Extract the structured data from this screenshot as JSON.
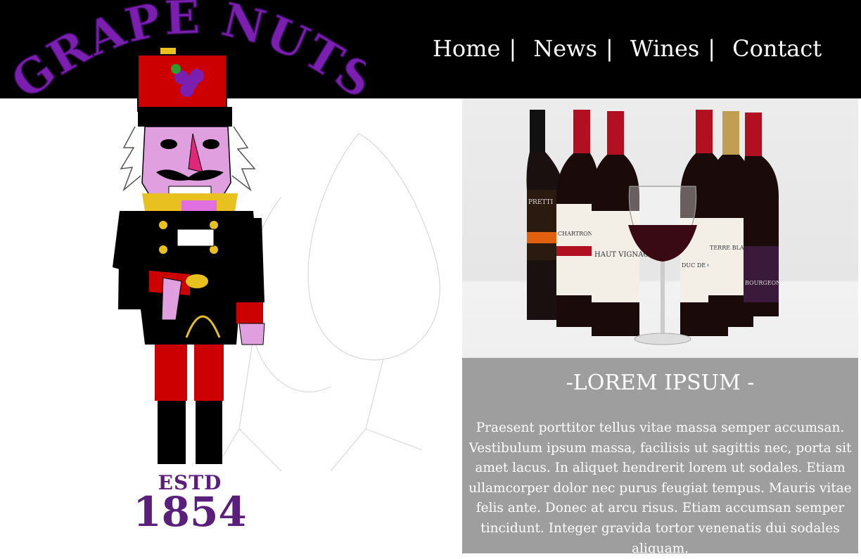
{
  "brand": {
    "logo_text": "GRAPE NUTS",
    "estd_label": "ESTD",
    "estd_year": "1854"
  },
  "nav": {
    "items": [
      {
        "label": "Home"
      },
      {
        "label": "News"
      },
      {
        "label": "Wines"
      },
      {
        "label": "Contact"
      }
    ],
    "separator": "|"
  },
  "hero": {
    "image_icon": "wine-bottles-photo",
    "bottle_labels": [
      "PRETTI",
      "CHARTRON",
      "HAUT VIGNAC",
      "DUC DE CASTELLE",
      "TERRE BLANCHE",
      "BOURGEON"
    ]
  },
  "panel": {
    "title": "-LOREM IPSUM -",
    "body": "Praesent porttitor tellus vitae massa semper accumsan. Vestibulum ipsum massa, facilisis ut sagittis nec, porta sit amet lacus. In aliquet hendrerit lorem ut sodales. Etiam ullamcorper dolor nec purus feugiat tempus. Mauris vitae felis ante. Donec at arcu risus. Etiam accumsan semper tincidunt. Integer gravida tortor venenatis dui sodales aliquam."
  },
  "colors": {
    "header_bg": "#000000",
    "logo_purple": "#7a1fb0",
    "panel_bg": "#9e9e9e",
    "hat_red": "#cc0000"
  }
}
